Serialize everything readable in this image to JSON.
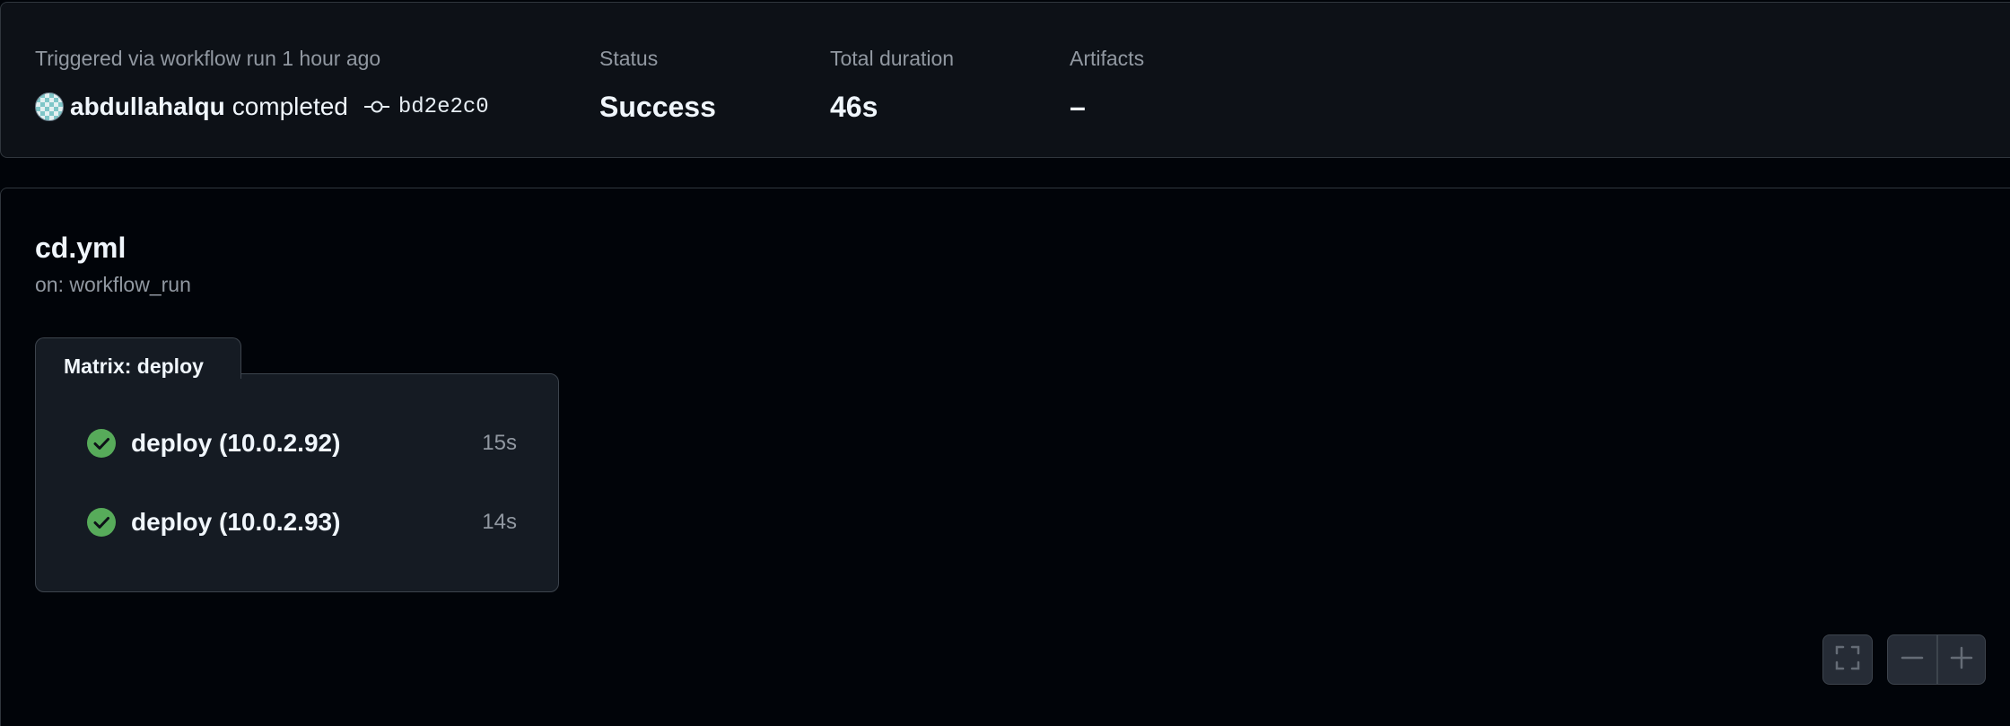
{
  "summary": {
    "trigger_label": "Triggered via workflow run 1 hour ago",
    "actor": "abdullahalqu",
    "actor_verb": "completed",
    "commit_sha": "bd2e2c0",
    "status_label": "Status",
    "status_value": "Success",
    "duration_label": "Total duration",
    "duration_value": "46s",
    "artifacts_label": "Artifacts",
    "artifacts_value": "–"
  },
  "workflow": {
    "file": "cd.yml",
    "trigger": "on: workflow_run",
    "matrix_title": "Matrix: deploy",
    "jobs": [
      {
        "name": "deploy (10.0.2.92)",
        "duration": "15s",
        "status": "success"
      },
      {
        "name": "deploy (10.0.2.93)",
        "duration": "14s",
        "status": "success"
      }
    ]
  },
  "controls": {
    "icons": [
      "fullscreen-icon",
      "zoom-out-icon",
      "zoom-in-icon"
    ]
  },
  "colors": {
    "success": "#57ab5a",
    "background": "#010409",
    "panel": "#0d1117",
    "border": "#30363d",
    "muted_text": "#9198a1"
  }
}
